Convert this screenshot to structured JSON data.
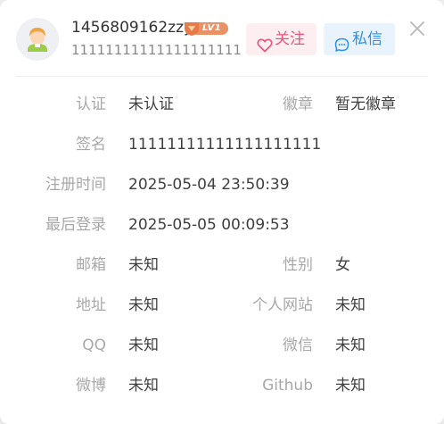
{
  "profile": {
    "username": "1456809162zzy",
    "level": "LV1",
    "signature": "11111111111111111111",
    "avatar_icon": "user-avatar-icon"
  },
  "actions": {
    "follow_label": "关注",
    "message_label": "私信",
    "follow_color": "#e8547c",
    "message_color": "#2f8fe8"
  },
  "details": {
    "verify_label": "认证",
    "verify_value": "未认证",
    "badge_label": "徽章",
    "badge_value": "暂无徽章",
    "sign_label": "签名",
    "sign_value": "11111111111111111111",
    "register_label": "注册时间",
    "register_value": "2025-05-04 23:50:39",
    "lastlogin_label": "最后登录",
    "lastlogin_value": "2025-05-05 00:09:53",
    "email_label": "邮箱",
    "email_value": "未知",
    "gender_label": "性别",
    "gender_value": "女",
    "address_label": "地址",
    "address_value": "未知",
    "website_label": "个人网站",
    "website_value": "未知",
    "qq_label": "QQ",
    "qq_value": "未知",
    "wechat_label": "微信",
    "wechat_value": "未知",
    "weibo_label": "微博",
    "weibo_value": "未知",
    "github_label": "Github",
    "github_value": "未知"
  }
}
